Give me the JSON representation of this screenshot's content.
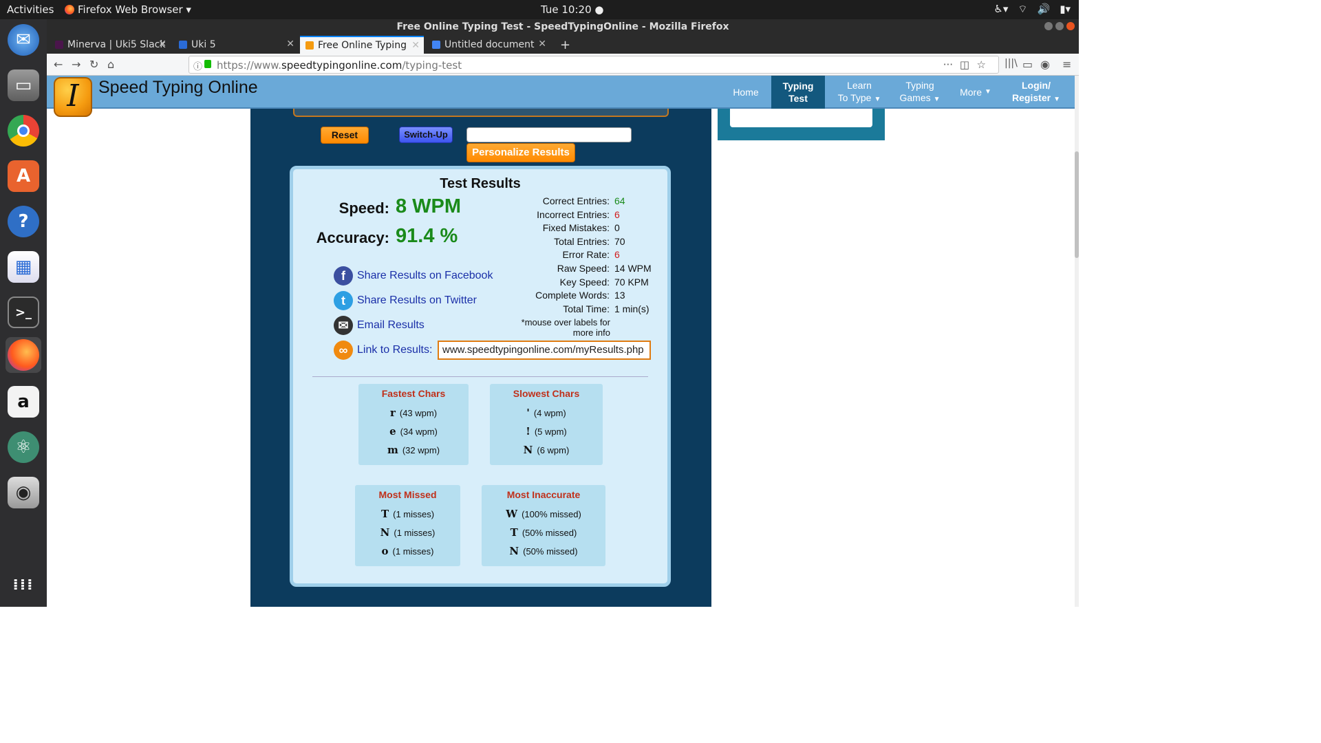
{
  "gnome": {
    "activities": "Activities",
    "app_name": "Firefox Web Browser ▾",
    "clock": "Tue 10:20 ●"
  },
  "window": {
    "title": "Free Online Typing Test - SpeedTypingOnline - Mozilla Firefox"
  },
  "tabs": [
    {
      "label": "Minerva | Uki5 Slack",
      "color": "#4a154b"
    },
    {
      "label": "Uki 5",
      "color": "#2a6bd6"
    },
    {
      "label": "Free Online Typing",
      "color": "#f59b10"
    },
    {
      "label": "Untitled document",
      "color": "#4285f4"
    }
  ],
  "url": {
    "prefix": "https://www.",
    "domain": "speedtypingonline.com",
    "path": "/typing-test"
  },
  "site": {
    "name": "Speed Typing Online",
    "logo_letter": "I",
    "nav": {
      "home": "Home",
      "typing_test_1": "Typing",
      "typing_test_2": "Test",
      "learn_1": "Learn",
      "learn_2": "To Type",
      "games_1": "Typing",
      "games_2": "Games",
      "more": "More",
      "login_1": "Login/",
      "login_2": "Register"
    }
  },
  "controls": {
    "reset": "Reset",
    "switchup": "Switch-Up",
    "personalize": "Personalize Results"
  },
  "results": {
    "title": "Test Results",
    "speed_label": "Speed:",
    "speed_value": "8 WPM",
    "accuracy_label": "Accuracy:",
    "accuracy_value": "91.4 %",
    "stats": [
      {
        "label": "Correct Entries:",
        "value": "64",
        "color": "green"
      },
      {
        "label": "Incorrect Entries:",
        "value": "6",
        "color": "red"
      },
      {
        "label": "Fixed Mistakes:",
        "value": "0",
        "color": ""
      },
      {
        "label": "Total Entries:",
        "value": "70",
        "color": ""
      },
      {
        "label": "Error Rate:",
        "value": "6",
        "color": "red"
      },
      {
        "label": "Raw Speed:",
        "value": "14 WPM",
        "color": ""
      },
      {
        "label": "Key Speed:",
        "value": "70 KPM",
        "color": ""
      },
      {
        "label": "Complete Words:",
        "value": "13",
        "color": ""
      },
      {
        "label": "Total Time:",
        "value": "1 min(s)",
        "color": ""
      }
    ],
    "note_1": "*mouse over labels for",
    "note_2": "more info",
    "share_facebook": "Share Results on Facebook",
    "share_twitter": "Share Results on Twitter",
    "email": "Email Results",
    "link_label": "Link to Results:",
    "link_value": "www.speedtypingonline.com/myResults.php"
  },
  "fastest": {
    "title": "Fastest Chars",
    "rows": [
      {
        "ch": "r",
        "txt": "(43 wpm)"
      },
      {
        "ch": "e",
        "txt": "(34 wpm)"
      },
      {
        "ch": "m",
        "txt": "(32 wpm)"
      }
    ]
  },
  "slowest": {
    "title": "Slowest Chars",
    "rows": [
      {
        "ch": "'",
        "txt": "(4 wpm)"
      },
      {
        "ch": "!",
        "txt": "(5 wpm)"
      },
      {
        "ch": "N",
        "txt": "(6 wpm)"
      }
    ]
  },
  "missed": {
    "title": "Most Missed",
    "rows": [
      {
        "ch": "T",
        "txt": "(1 misses)"
      },
      {
        "ch": "N",
        "txt": "(1 misses)"
      },
      {
        "ch": "o",
        "txt": "(1 misses)"
      }
    ]
  },
  "inaccurate": {
    "title": "Most Inaccurate",
    "rows": [
      {
        "ch": "W",
        "txt": "(100% missed)"
      },
      {
        "ch": "T",
        "txt": "(50% missed)"
      },
      {
        "ch": "N",
        "txt": "(50% missed)"
      }
    ]
  }
}
